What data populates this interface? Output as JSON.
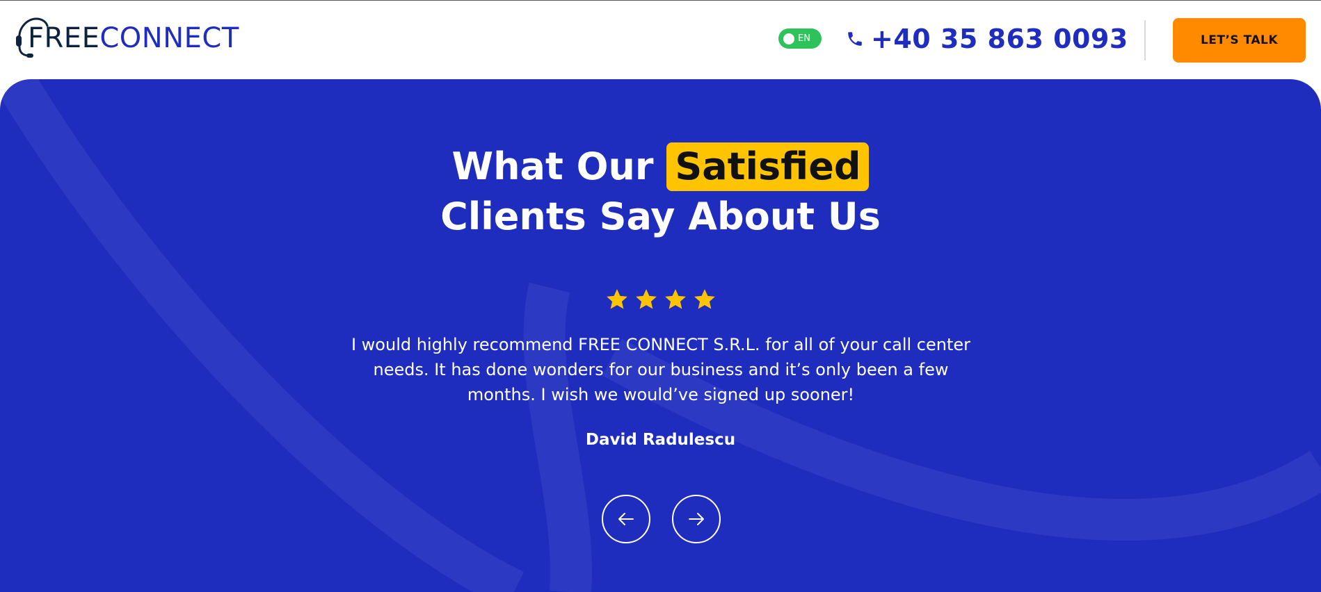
{
  "header": {
    "logo_free": "FREE",
    "logo_connect": "CONNECT",
    "language": "EN",
    "phone": "+40 35 863 0093",
    "cta_label": "LET’S TALK"
  },
  "testimonials": {
    "heading_prefix": "What Our",
    "heading_highlight": "Satisfied",
    "heading_line2": "Clients Say About Us",
    "rating": 4,
    "quote": "I would highly recommend FREE CONNECT S.R.L. for all of your call center needs. It has done wonders for our business and it’s only been a few months. I wish we would’ve signed up sooner!",
    "author": "David Radulescu"
  },
  "colors": {
    "brand_blue": "#1f2dbf",
    "brand_navy": "#0c2340",
    "highlight_yellow": "#ffc400",
    "cta_orange": "#ff8a00",
    "toggle_green": "#2ec25a"
  },
  "icons": {
    "phone": "phone-icon",
    "prev": "arrow-left-icon",
    "next": "arrow-right-icon",
    "star": "star-icon",
    "logo": "headset-icon"
  }
}
